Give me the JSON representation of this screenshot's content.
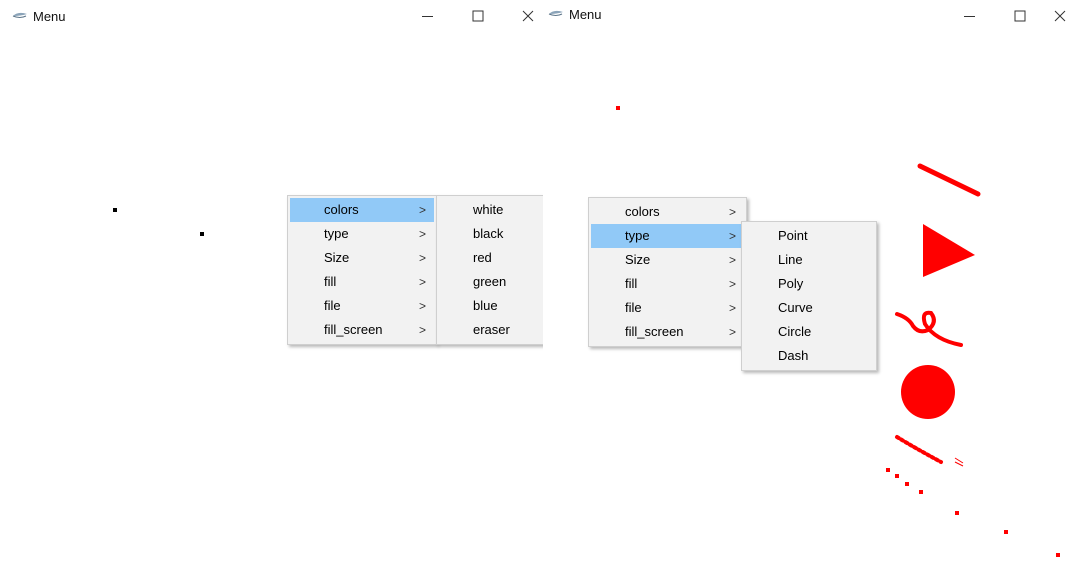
{
  "left_window": {
    "title": "Menu",
    "menu": [
      {
        "label": "colors",
        "arrow": ">"
      },
      {
        "label": "type",
        "arrow": ">"
      },
      {
        "label": "Size",
        "arrow": ">"
      },
      {
        "label": "fill",
        "arrow": ">"
      },
      {
        "label": "file",
        "arrow": ">"
      },
      {
        "label": "fill_screen",
        "arrow": ">"
      }
    ],
    "submenu": [
      "white",
      "black",
      "red",
      "green",
      "blue",
      "eraser"
    ]
  },
  "right_window": {
    "title": "Menu",
    "menu": [
      {
        "label": "colors",
        "arrow": ">"
      },
      {
        "label": "type",
        "arrow": ">"
      },
      {
        "label": "Size",
        "arrow": ">"
      },
      {
        "label": "fill",
        "arrow": ">"
      },
      {
        "label": "file",
        "arrow": ">"
      },
      {
        "label": "fill_screen",
        "arrow": ">"
      }
    ],
    "submenu": [
      "Point",
      "Line",
      "Poly",
      "Curve",
      "Circle",
      "Dash"
    ]
  },
  "colors": {
    "highlight": "#91c9f7",
    "drawing_red": "#ff0000",
    "drawing_black": "#000000"
  },
  "icons": [
    "app-icon",
    "minimize-icon",
    "maximize-icon",
    "close-icon",
    "chevron-right-icon"
  ]
}
